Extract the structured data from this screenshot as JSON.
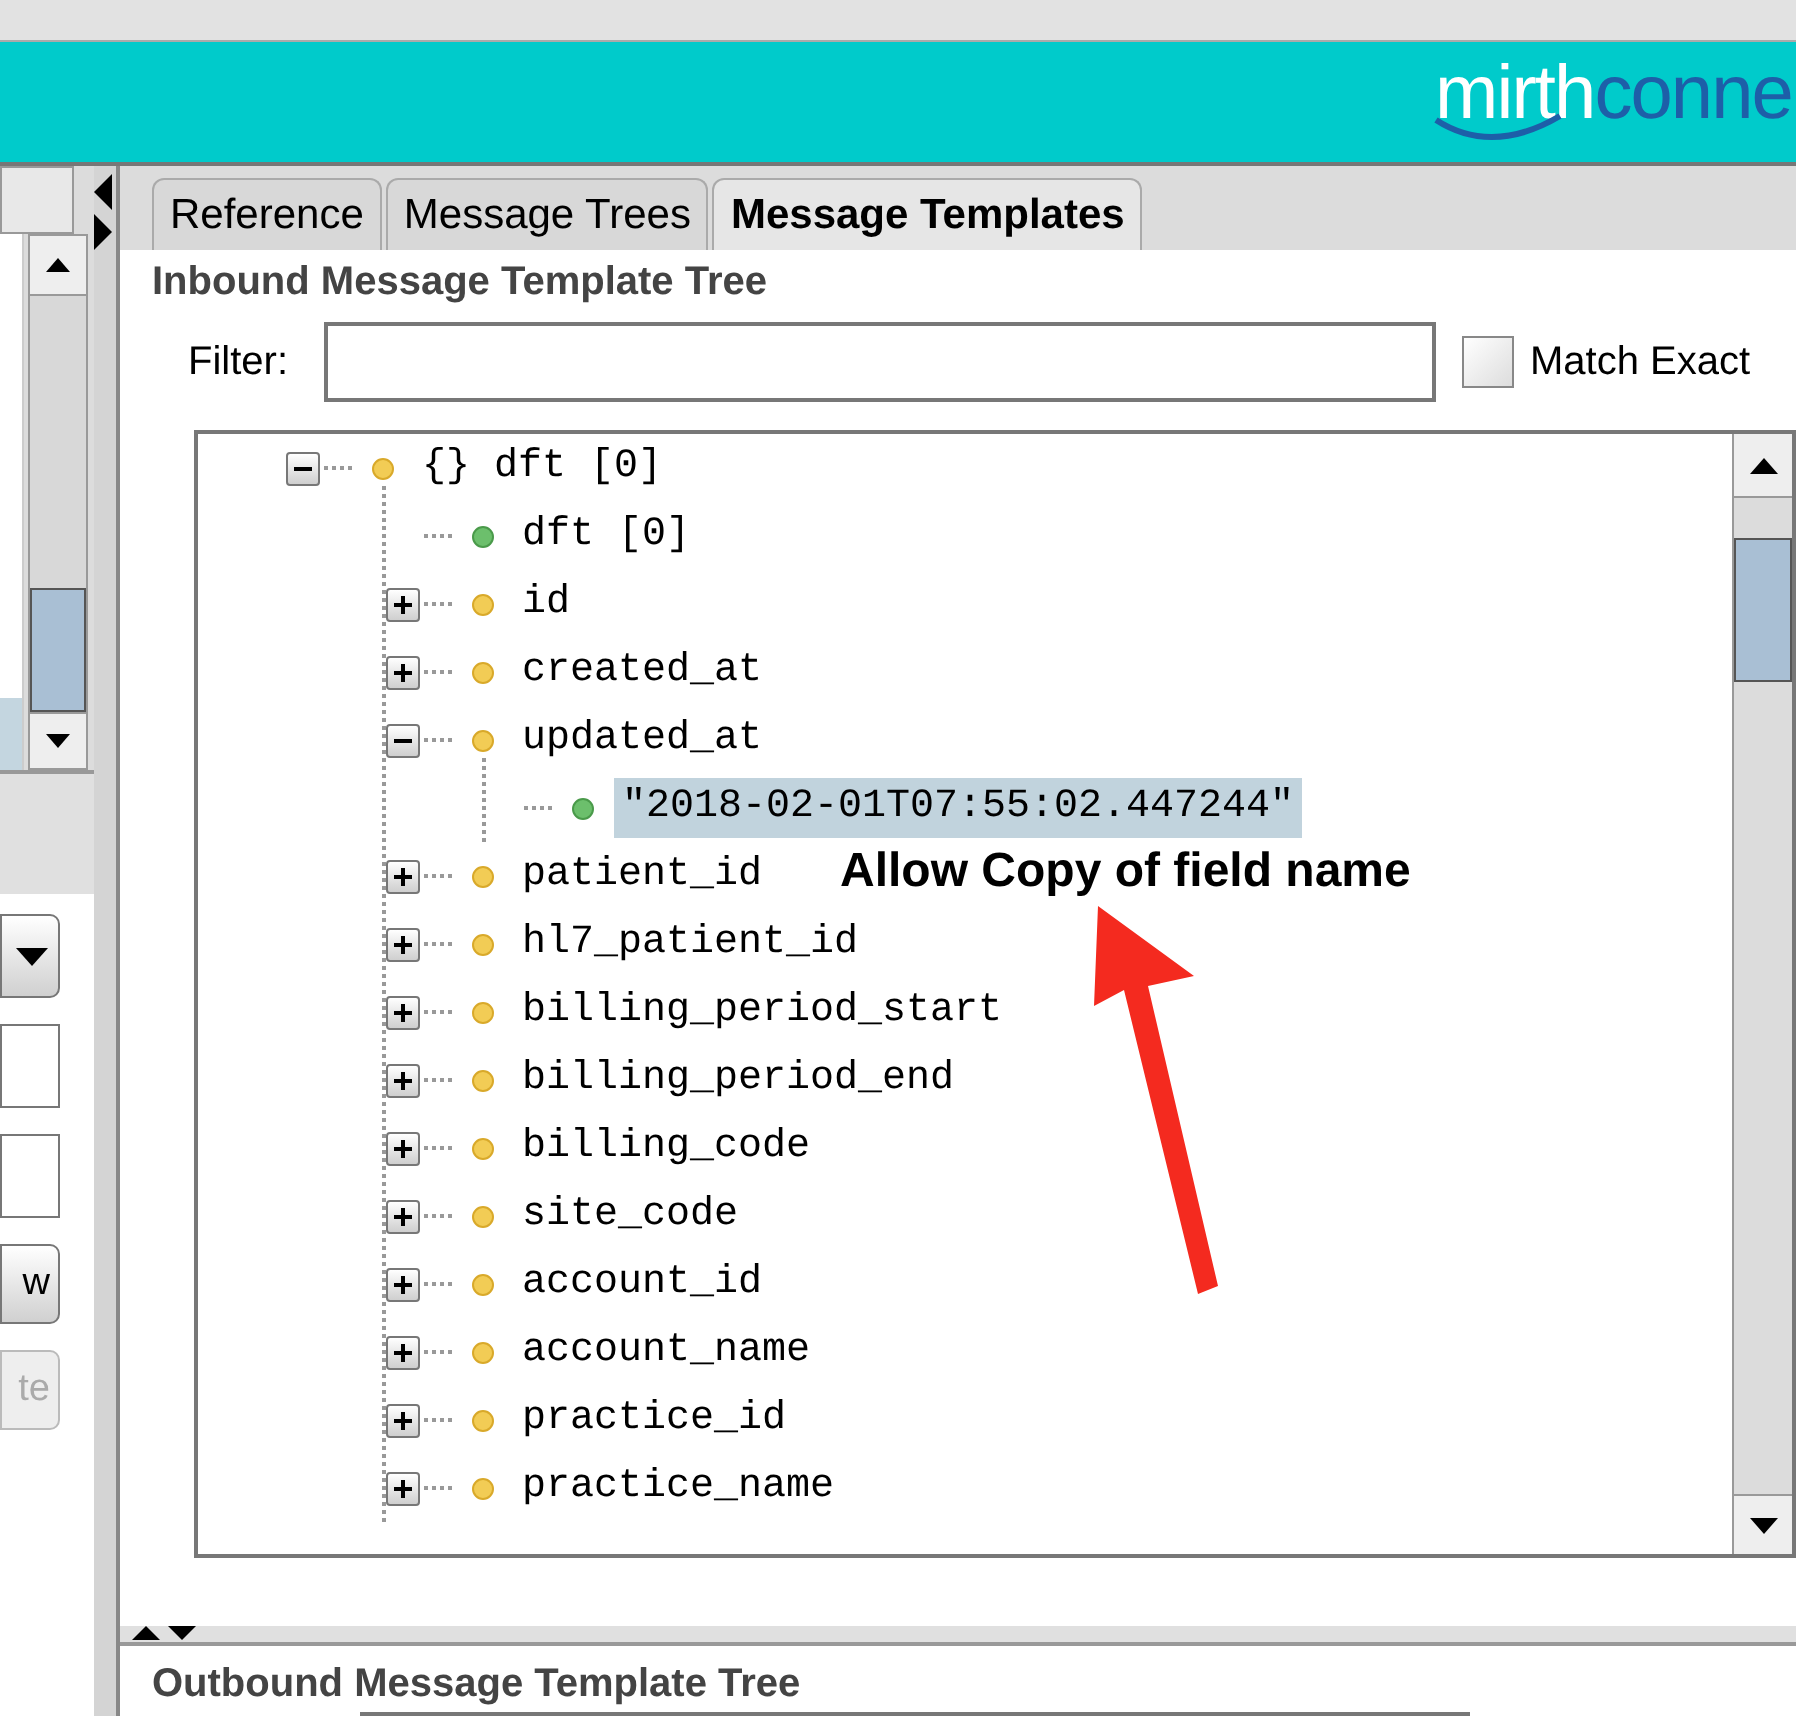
{
  "header": {
    "logo_primary": "mirth",
    "logo_secondary": "conne"
  },
  "left_panel": {
    "buttons": [
      {
        "label": "w",
        "disabled": false
      },
      {
        "label": "te",
        "disabled": true
      }
    ]
  },
  "tabs": [
    {
      "label": "Reference",
      "selected": false
    },
    {
      "label": "Message Trees",
      "selected": false
    },
    {
      "label": "Message Templates",
      "selected": true
    }
  ],
  "inbound": {
    "title": "Inbound Message Template Tree",
    "filter_label": "Filter:",
    "match_exact": {
      "label": "Match Exact",
      "checked": false
    },
    "tree": [
      {
        "label": "{} dft [0]",
        "kind": "object",
        "expanded": true,
        "selected": false,
        "children": [
          {
            "label": "dft [0]",
            "kind": "value",
            "selected": false
          },
          {
            "label": "id",
            "kind": "object",
            "expanded": false,
            "selected": false
          },
          {
            "label": "created_at",
            "kind": "object",
            "expanded": false,
            "selected": false
          },
          {
            "label": "updated_at",
            "kind": "object",
            "expanded": true,
            "selected": false,
            "children": [
              {
                "label": "\"2018-02-01T07:55:02.447244\"",
                "kind": "value",
                "selected": true
              }
            ]
          },
          {
            "label": "patient_id",
            "kind": "object",
            "expanded": false,
            "selected": false
          },
          {
            "label": "hl7_patient_id",
            "kind": "object",
            "expanded": false,
            "selected": false
          },
          {
            "label": "billing_period_start",
            "kind": "object",
            "expanded": false,
            "selected": false
          },
          {
            "label": "billing_period_end",
            "kind": "object",
            "expanded": false,
            "selected": false
          },
          {
            "label": "billing_code",
            "kind": "object",
            "expanded": false,
            "selected": false
          },
          {
            "label": "site_code",
            "kind": "object",
            "expanded": false,
            "selected": false
          },
          {
            "label": "account_id",
            "kind": "object",
            "expanded": false,
            "selected": false
          },
          {
            "label": "account_name",
            "kind": "object",
            "expanded": false,
            "selected": false
          },
          {
            "label": "practice_id",
            "kind": "object",
            "expanded": false,
            "selected": false
          },
          {
            "label": "practice_name",
            "kind": "object",
            "expanded": false,
            "selected": false
          }
        ]
      }
    ]
  },
  "annotation": {
    "text": "Allow Copy of field name"
  },
  "outbound": {
    "title": "Outbound Message Template Tree"
  }
}
